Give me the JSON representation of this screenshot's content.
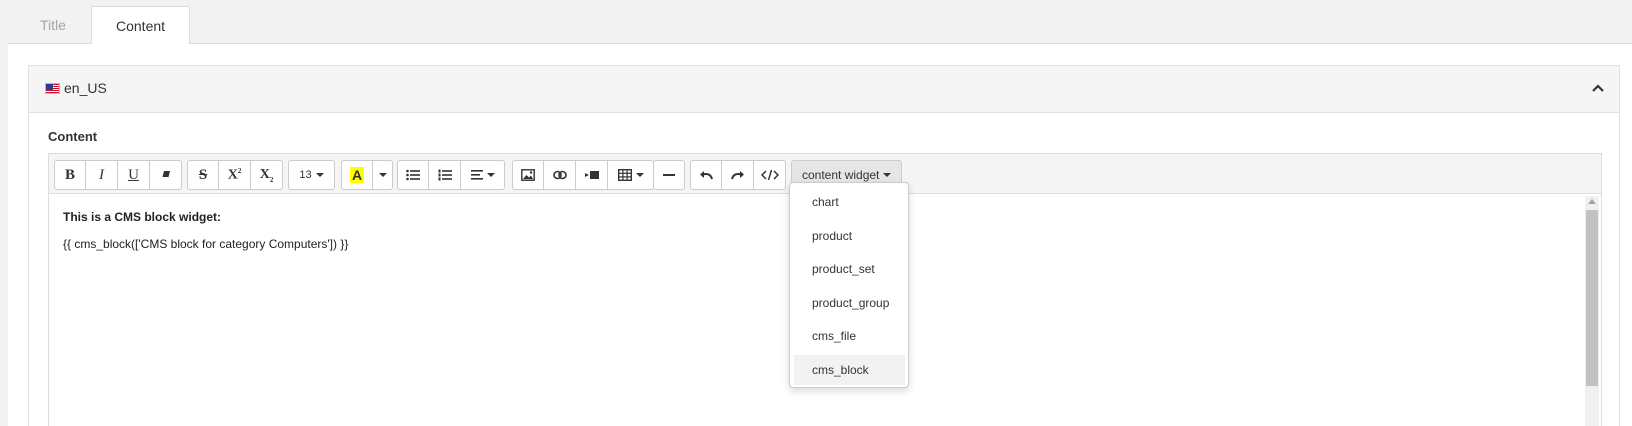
{
  "tabs": [
    {
      "label": "Title",
      "active": false
    },
    {
      "label": "Content",
      "active": true
    }
  ],
  "box": {
    "locale": "en_US",
    "flag_icon": "us-flag-icon",
    "collapse_icon": "chevron-up-icon"
  },
  "field": {
    "label": "Content"
  },
  "toolbar": {
    "bold": "B",
    "italic": "I",
    "underline": "U",
    "strikethrough": "S",
    "superscript": "X",
    "subscript": "X",
    "font_size": "13",
    "highlight": "A",
    "highlight_color": "#ffff00",
    "content_widget_label": "content widget"
  },
  "editor": {
    "line1": "This is a CMS block widget:",
    "line2": "{{ cms_block(['CMS block for category Computers']) }}"
  },
  "dropdown": {
    "items": [
      "chart",
      "product",
      "product_set",
      "product_group",
      "cms_file",
      "cms_block"
    ],
    "highlighted": "cms_block"
  }
}
